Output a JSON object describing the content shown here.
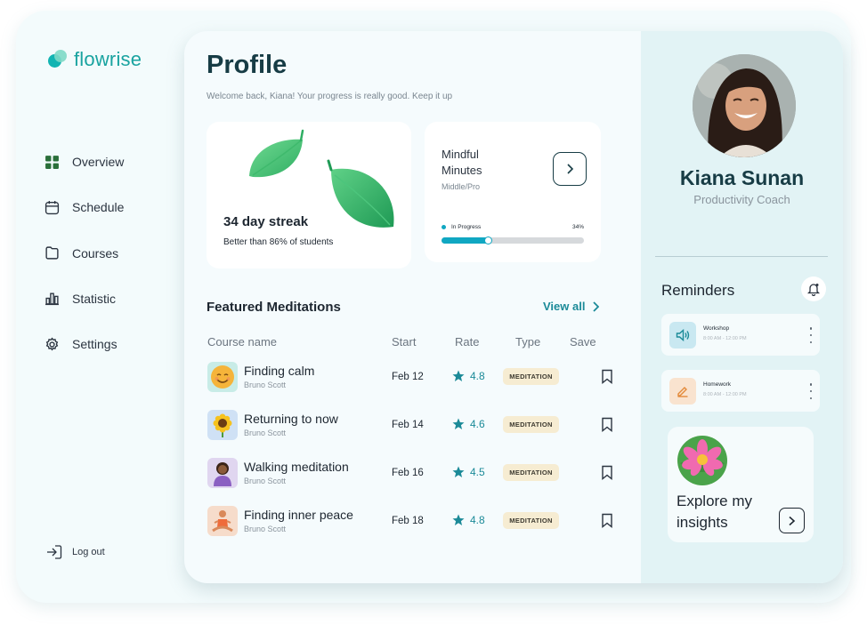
{
  "app": {
    "name": "flowrise"
  },
  "sidebar": {
    "items": [
      {
        "label": "Overview",
        "icon": "grid-icon",
        "active": true
      },
      {
        "label": "Schedule",
        "icon": "calendar-icon"
      },
      {
        "label": "Courses",
        "icon": "folder-icon"
      },
      {
        "label": "Statistic",
        "icon": "bar-chart-icon"
      },
      {
        "label": "Settings",
        "icon": "gear-icon"
      }
    ],
    "logout_label": "Log out"
  },
  "header": {
    "title": "Profile",
    "subtitle": "Welcome back, Kiana! Your progress is really good. Keep it up"
  },
  "streak_card": {
    "title": "34 day streak",
    "subtitle": "Better than 86% of students"
  },
  "mindful_card": {
    "title": "Mindful Minutes",
    "level": "Middle/Pro",
    "progress_label": "In Progress",
    "progress_text": "34%",
    "progress_value": 0.34
  },
  "featured": {
    "title": "Featured Meditations",
    "view_all": "View all",
    "columns": {
      "name": "Course name",
      "start": "Start",
      "rate": "Rate",
      "type": "Type",
      "save": "Save"
    },
    "rows": [
      {
        "name": "Finding calm",
        "author": "Bruno Scott",
        "start": "Feb 12",
        "rate": "4.8",
        "type": "MEDITATION",
        "thumb": "smiling-face-icon"
      },
      {
        "name": "Returning to now",
        "author": "Bruno Scott",
        "start": "Feb 14",
        "rate": "4.6",
        "type": "MEDITATION",
        "thumb": "sunflower-icon"
      },
      {
        "name": "Walking meditation",
        "author": "Bruno Scott",
        "start": "Feb 16",
        "rate": "4.5",
        "type": "MEDITATION",
        "thumb": "person-icon"
      },
      {
        "name": "Finding inner peace",
        "author": "Bruno Scott",
        "start": "Feb 18",
        "rate": "4.8",
        "type": "MEDITATION",
        "thumb": "lotus-pose-icon"
      }
    ]
  },
  "profile": {
    "name": "Kiana Sunan",
    "role": "Productivity Coach"
  },
  "reminders": {
    "title": "Reminders",
    "items": [
      {
        "name": "Workshop",
        "time": "8:00 AM - 12:00 PM",
        "icon": "speaker-icon"
      },
      {
        "name": "Homework",
        "time": "8:00 AM - 12:00 PM",
        "icon": "pencil-icon"
      }
    ]
  },
  "insights": {
    "label": "Explore my insights"
  },
  "colors": {
    "accent": "#1b8a98",
    "teal": "#10a7c2",
    "dark": "#173c45",
    "badge": "#f6ecd2"
  }
}
